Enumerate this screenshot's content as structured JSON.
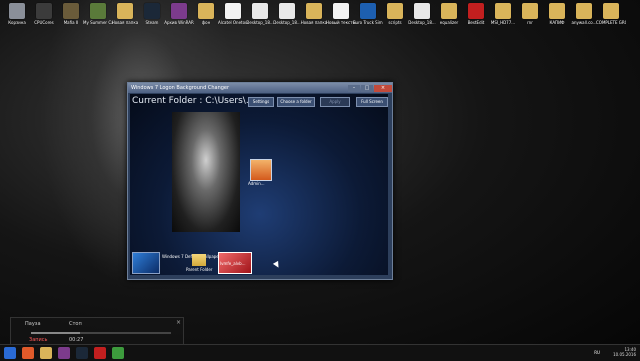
{
  "window": {
    "title": "Windows 7 Logon Background Changer",
    "current_folder": "Current Folder : C:\\Users\\...",
    "buttons": {
      "settings": "Settings",
      "choose_folder": "Choose a folder",
      "apply": "Apply",
      "full_screen": "Full Screen"
    },
    "avatar_label": "Admin...",
    "thumbnails": [
      {
        "label": "Windows 7 Default wallpaper"
      },
      {
        "label": "Parent Folder"
      },
      {
        "label": "lvmfe_alvb..."
      }
    ]
  },
  "desktop_icons": [
    {
      "label": "Корзина",
      "color": "#8a8f99"
    },
    {
      "label": "CPUCores",
      "color": "#3b3b3b"
    },
    {
      "label": "Mafia II",
      "color": "#6a5b3a"
    },
    {
      "label": "My Summer Car",
      "color": "#5a7a3a"
    },
    {
      "label": "Новая папка",
      "color": "#d9b45a"
    },
    {
      "label": "Steam",
      "color": "#1b2838"
    },
    {
      "label": "Архив WinRAR",
      "color": "#7c3b8c"
    },
    {
      "label": "фон",
      "color": "#d9b45a"
    },
    {
      "label": "Alcatel Onetouch",
      "color": "#f2f2f2"
    },
    {
      "label": "Desktop_18...",
      "color": "#e8e8e8"
    },
    {
      "label": "Desktop_18...",
      "color": "#e8e8e8"
    },
    {
      "label": "Новая папка",
      "color": "#d9b45a"
    },
    {
      "label": "Новый текстовый",
      "color": "#f2f2f2"
    },
    {
      "label": "Euro Truck Simulator",
      "color": "#1d5fb0"
    },
    {
      "label": "scripts",
      "color": "#d9b45a"
    },
    {
      "label": "Desktop_18...",
      "color": "#e8e8e8"
    },
    {
      "label": "equalizer",
      "color": "#d9b45a"
    },
    {
      "label": "BestEdit",
      "color": "#c21f1f"
    },
    {
      "label": "MSI_HD77...",
      "color": "#d9b45a"
    },
    {
      "label": "rnr",
      "color": "#d9b45a"
    },
    {
      "label": "КАПИФ",
      "color": "#d9b45a"
    },
    {
      "label": "anywall.co...",
      "color": "#d9b45a"
    },
    {
      "label": "COMPLETE GROUND",
      "color": "#d9b45a"
    }
  ],
  "recorder": {
    "pause_label": "Пауза",
    "stop_label": "Стоп",
    "status": "Запись",
    "time": "00:27",
    "close": "×",
    "progress": 0.35
  },
  "taskbar": {
    "time": "13:40",
    "date": "10.05.2016",
    "lang": "RU"
  }
}
